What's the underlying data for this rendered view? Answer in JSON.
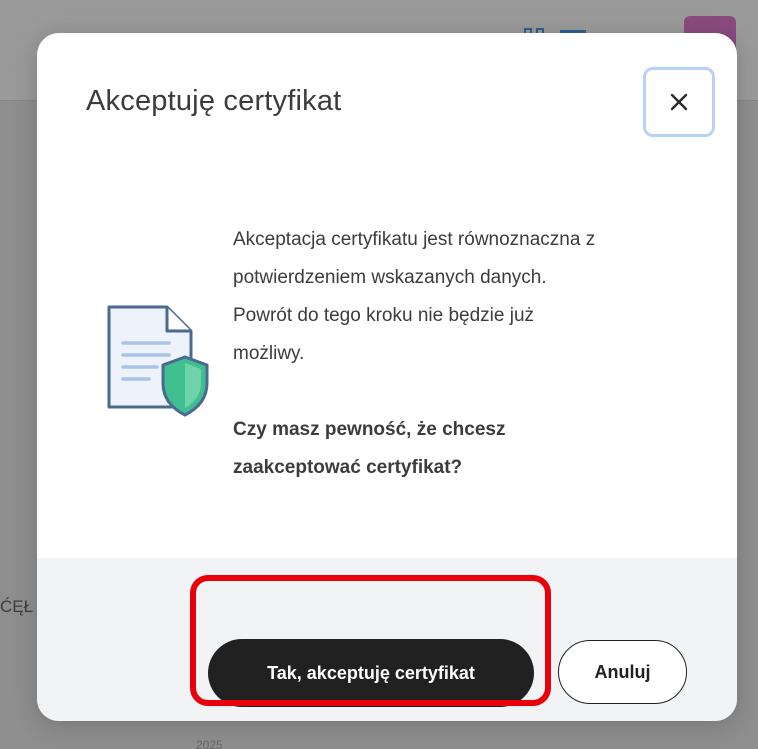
{
  "background": {
    "fragment_left": "ĆĘŁ",
    "fragment_bottom": "2025"
  },
  "dialog": {
    "title": "Akceptuję certyfikat",
    "close_icon": "close-icon",
    "illustration_icon": "document-shield-icon",
    "paragraph_lines": [
      "Akceptacja certyfikatu jest równoznaczna z",
      "potwierdzeniem wskazanych danych.",
      "Powrót do tego kroku nie będzie już",
      "możliwy."
    ],
    "question_lines": [
      "Czy masz pewność, że chcesz",
      "zaakceptować certyfikat?"
    ],
    "confirm_label": "Tak, akceptuję certyfikat",
    "cancel_label": "Anuluj"
  },
  "colors": {
    "overlay": "#8e8e8e",
    "primary_button": "#212121",
    "focus_ring": "#b6d3f5",
    "annotation": "#e8000b",
    "shield": "#3fbf8f",
    "document_stroke": "#4a6a92"
  }
}
